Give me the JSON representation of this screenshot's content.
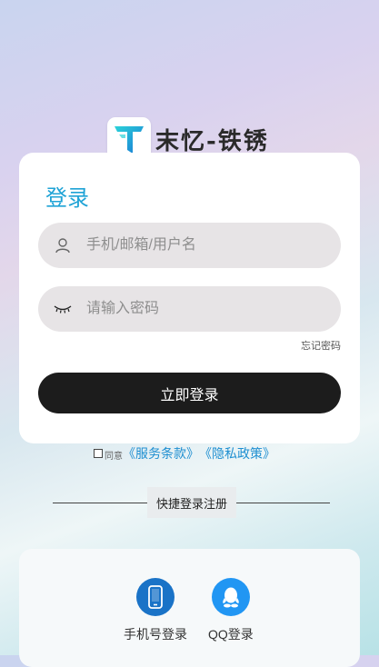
{
  "app": {
    "logo_letter": "T",
    "brand_name": "末忆-铁锈"
  },
  "login_card": {
    "title": "登录",
    "username_placeholder": "手机/邮箱/用户名",
    "password_placeholder": "请输入密码",
    "forgot_password": "忘记密码",
    "login_button": "立即登录"
  },
  "agreement": {
    "prefix": "同意",
    "terms_link": "《服务条款》",
    "privacy_link": "《隐私政策》",
    "checked": false
  },
  "quick_login": {
    "section_label": "快捷登录注册",
    "options": [
      {
        "label": "手机号登录",
        "icon": "phone-icon",
        "color": "#1a73c7"
      },
      {
        "label": "QQ登录",
        "icon": "qq-icon",
        "color": "#2196f3"
      }
    ]
  },
  "colors": {
    "accent": "#1fa3d6",
    "button": "#1c1c1c",
    "link": "#1f8fd1"
  }
}
